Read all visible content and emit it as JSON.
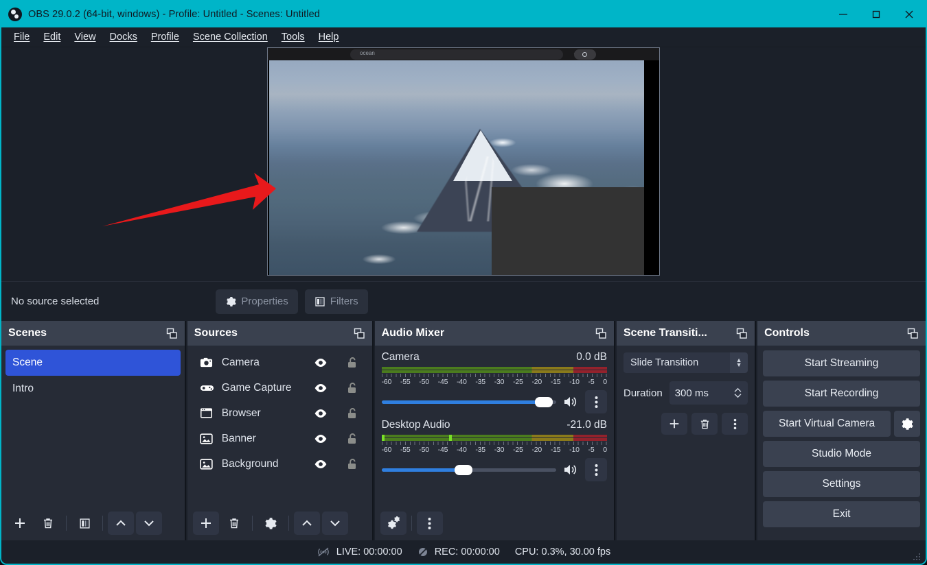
{
  "window": {
    "title": "OBS 29.0.2 (64-bit, windows) - Profile: Untitled - Scenes: Untitled",
    "accent_color": "#00b5c8",
    "background_color": "#1e232e",
    "selection_color": "#2f54d8",
    "minimize_label": "Minimize",
    "maximize_label": "Maximize",
    "close_label": "Close"
  },
  "menubar": {
    "items": [
      {
        "label": "File",
        "mnemonic": "F"
      },
      {
        "label": "Edit",
        "mnemonic": "E"
      },
      {
        "label": "View",
        "mnemonic": "V"
      },
      {
        "label": "Docks",
        "mnemonic": "D"
      },
      {
        "label": "Profile",
        "mnemonic": "P"
      },
      {
        "label": "Scene Collection",
        "mnemonic": "S"
      },
      {
        "label": "Tools",
        "mnemonic": "T"
      },
      {
        "label": "Help",
        "mnemonic": "H"
      }
    ]
  },
  "preview": {
    "browser_url_text": "ocean",
    "description": "Aerial view of a snow-capped mountain above clouds",
    "overlay_color": "#333333",
    "annotation": {
      "type": "arrow",
      "color": "#e8191b",
      "points": "from (147,260) to (398,205)"
    }
  },
  "source_toolbar": {
    "status_text": "No source selected",
    "properties_label": "Properties",
    "filters_label": "Filters"
  },
  "scenes": {
    "title": "Scenes",
    "items": [
      {
        "label": "Scene",
        "selected": true
      },
      {
        "label": "Intro",
        "selected": false
      }
    ],
    "footer": [
      {
        "name": "add-scene",
        "icon": "plus-icon"
      },
      {
        "name": "remove-scene",
        "icon": "trash-icon"
      },
      {
        "name": "scene-filters",
        "icon": "filters-icon"
      },
      {
        "name": "move-scene-up",
        "icon": "chevron-up-icon"
      },
      {
        "name": "move-scene-down",
        "icon": "chevron-down-icon"
      }
    ]
  },
  "sources": {
    "title": "Sources",
    "items": [
      {
        "label": "Camera",
        "icon": "camera-icon",
        "visible": true,
        "locked": false
      },
      {
        "label": "Game Capture",
        "icon": "gamepad-icon",
        "visible": true,
        "locked": false
      },
      {
        "label": "Browser",
        "icon": "browser-window-icon",
        "visible": true,
        "locked": false
      },
      {
        "label": "Banner",
        "icon": "image-icon",
        "visible": true,
        "locked": false
      },
      {
        "label": "Background",
        "icon": "image-icon",
        "visible": true,
        "locked": false
      }
    ],
    "footer": [
      {
        "name": "add-source",
        "icon": "plus-icon"
      },
      {
        "name": "remove-source",
        "icon": "trash-icon"
      },
      {
        "name": "source-properties",
        "icon": "gear-icon"
      },
      {
        "name": "move-source-up",
        "icon": "chevron-up-icon"
      },
      {
        "name": "move-source-down",
        "icon": "chevron-down-icon"
      }
    ]
  },
  "audio_mixer": {
    "title": "Audio Mixer",
    "scale_labels": [
      "-60",
      "-55",
      "-50",
      "-45",
      "-40",
      "-35",
      "-30",
      "-25",
      "-20",
      "-15",
      "-10",
      "-5",
      "0"
    ],
    "channels": [
      {
        "name": "Camera",
        "level": "0.0 dB",
        "volume_percent": 100,
        "muted": false,
        "peaks": []
      },
      {
        "name": "Desktop Audio",
        "level": "-21.0 dB",
        "volume_percent": 45,
        "muted": false,
        "peaks": [
          0,
          30
        ]
      }
    ],
    "footer": [
      {
        "name": "advanced-audio-properties",
        "icon": "double-gear-icon"
      },
      {
        "name": "mixer-menu",
        "icon": "vertical-dots-icon"
      }
    ]
  },
  "scene_transitions": {
    "title": "Scene Transiti...",
    "transition_value": "Slide Transition",
    "duration_label": "Duration",
    "duration_value": "300 ms",
    "footer": [
      {
        "name": "add-transition",
        "icon": "plus-icon"
      },
      {
        "name": "remove-transition",
        "icon": "trash-icon"
      },
      {
        "name": "transition-menu",
        "icon": "vertical-dots-icon"
      }
    ]
  },
  "controls": {
    "title": "Controls",
    "buttons": [
      {
        "label": "Start Streaming",
        "name": "start-streaming-button"
      },
      {
        "label": "Start Recording",
        "name": "start-recording-button"
      },
      {
        "label": "Start Virtual Camera",
        "name": "start-virtual-camera-button"
      },
      {
        "label": "Studio Mode",
        "name": "studio-mode-button"
      },
      {
        "label": "Settings",
        "name": "settings-button"
      },
      {
        "label": "Exit",
        "name": "exit-button"
      }
    ],
    "virtual_camera_config_icon": "gear-icon"
  },
  "statusbar": {
    "live_label": "LIVE: 00:00:00",
    "rec_label": "REC: 00:00:00",
    "cpu_label": "CPU: 0.3%, 30.00 fps"
  }
}
